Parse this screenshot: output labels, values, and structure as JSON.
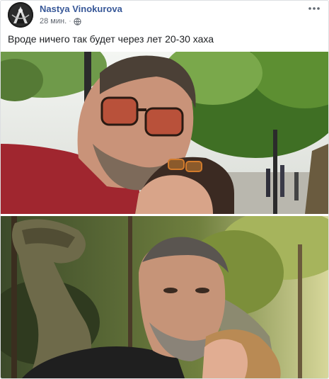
{
  "post": {
    "author": "Nastya Vinokurova",
    "timestamp": "28 мин.",
    "separator": "·",
    "privacy_icon": "globe-icon",
    "more_icon": "more-options-icon",
    "text": "Вроде ничего так будет через лет 20-30 хаха",
    "photos": [
      {
        "subject": "selfie-city-street"
      },
      {
        "subject": "selfie-dinosaur-park"
      }
    ]
  },
  "colors": {
    "author_link": "#385898",
    "meta_text": "#616770",
    "body_text": "#1c1e21",
    "border": "#dddfe2"
  }
}
